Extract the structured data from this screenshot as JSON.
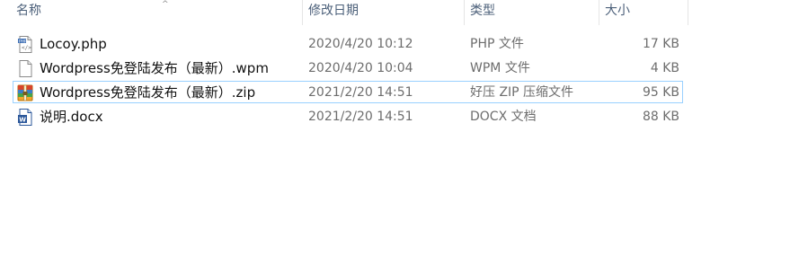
{
  "columns": {
    "name": "名称",
    "date": "修改日期",
    "type": "类型",
    "size": "大小",
    "sort_indicator": "^"
  },
  "files": [
    {
      "name": "Locoy.php",
      "date": "2020/4/20 10:12",
      "type": "PHP 文件",
      "size": "17 KB",
      "icon": "php-file-icon"
    },
    {
      "name": "Wordpress免登陆发布（最新）.wpm",
      "date": "2020/4/20 10:04",
      "type": "WPM 文件",
      "size": "4 KB",
      "icon": "blank-file-icon"
    },
    {
      "name": "Wordpress免登陆发布（最新）.zip",
      "date": "2021/2/20 14:51",
      "type": "好压 ZIP 压缩文件",
      "size": "95 KB",
      "icon": "zip-archive-icon"
    },
    {
      "name": "说明.docx",
      "date": "2021/2/20 14:51",
      "type": "DOCX 文档",
      "size": "88 KB",
      "icon": "word-document-icon"
    }
  ],
  "selected_index": 2,
  "colors": {
    "header_text": "#4c607a",
    "detail_text": "#6d6d6d",
    "selection_border": "#99d1ff"
  }
}
